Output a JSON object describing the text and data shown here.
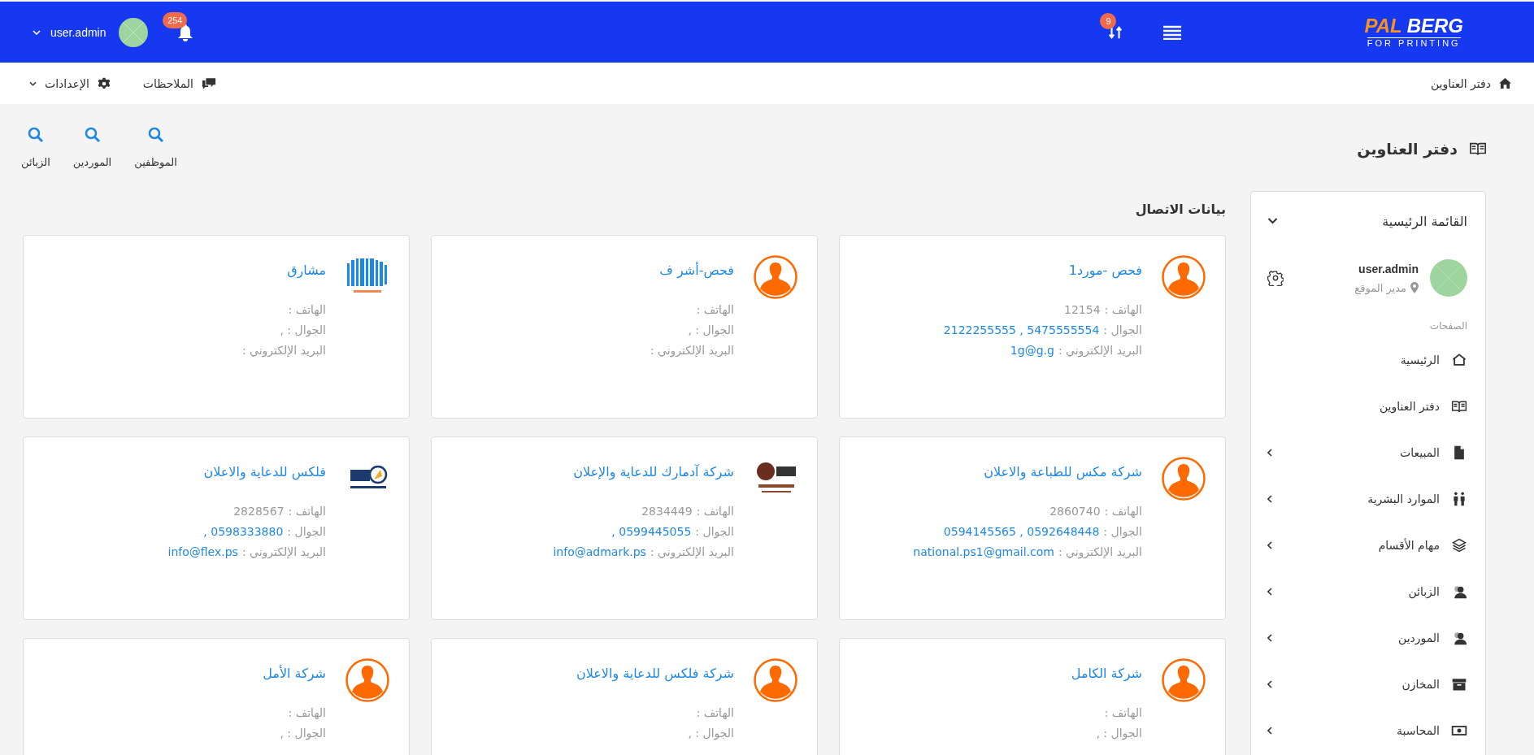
{
  "topbar": {
    "logo": {
      "words": [
        "BERG",
        "PAL"
      ],
      "tagline": "FOR PRINTING"
    },
    "sync_badge": "9",
    "notifications_badge": "254",
    "user": "user.admin"
  },
  "subbar": {
    "breadcrumb": "دفتر العناوين",
    "notes": "الملاحظات",
    "settings": "الإعدادات"
  },
  "page_title": "دفتر العناوين",
  "quick_search": [
    "الموظفين",
    "الموردين",
    "الزبائن"
  ],
  "section_title": "بيانات الاتصال",
  "contacts": [
    {
      "name": "فحص -مورد1",
      "kind": "avatar",
      "lines": [
        {
          "label": "الهاتف :",
          "value": "12154",
          "link": false
        },
        {
          "label": "الجوال :",
          "value": "5475555554 , 2122255555",
          "link": true
        },
        {
          "label": "البريد الإلكتروني :",
          "value": "1g@g.g",
          "link": true
        }
      ]
    },
    {
      "name": "فحص-أشر ف",
      "kind": "avatar",
      "lines": [
        {
          "label": "الهاتف :"
        },
        {
          "label": "الجوال : ,"
        },
        {
          "label": "البريد الإلكتروني :"
        }
      ]
    },
    {
      "name": "مشارق",
      "kind": "stripes",
      "lines": [
        {
          "label": "الهاتف :"
        },
        {
          "label": "الجوال : ,"
        },
        {
          "label": "البريد الإلكتروني :"
        }
      ]
    },
    {
      "name": "شركة مكس للطباعة والاعلان",
      "kind": "avatar",
      "lines": [
        {
          "label": "الهاتف :",
          "value": "2860740",
          "link": false
        },
        {
          "label": "الجوال :",
          "value": "0592648448 , 0594145565",
          "link": true
        },
        {
          "label": "البريد الإلكتروني :",
          "value": "national.ps1@gmail.com",
          "link": true
        }
      ]
    },
    {
      "name": "شركة آدمارك للدعاية والإعلان",
      "kind": "monogram",
      "lines": [
        {
          "label": "الهاتف :",
          "value": "2834449",
          "link": false
        },
        {
          "label": "الجوال :",
          "value": "0599445055 ,",
          "link": true
        },
        {
          "label": "البريد الإلكتروني :",
          "value": "info@admark.ps",
          "link": true
        }
      ]
    },
    {
      "name": "فلكس للدعاية والاعلان",
      "kind": "emblem",
      "lines": [
        {
          "label": "الهاتف :",
          "value": "2828567",
          "link": false
        },
        {
          "label": "الجوال :",
          "value": "0598333880 ,",
          "link": true
        },
        {
          "label": "البريد الإلكتروني :",
          "value": "info@flex.ps",
          "link": true
        }
      ]
    },
    {
      "name": "شركة الكامل",
      "kind": "avatar",
      "lines": [
        {
          "label": "الهاتف :"
        },
        {
          "label": "الجوال : ,"
        }
      ]
    },
    {
      "name": "شركة فلكس للدعاية والاعلان",
      "kind": "avatar",
      "lines": [
        {
          "label": "الهاتف :"
        },
        {
          "label": "الجوال : ,"
        }
      ]
    },
    {
      "name": "شركة الأمل",
      "kind": "avatar",
      "lines": [
        {
          "label": "الهاتف :"
        },
        {
          "label": "الجوال : ,"
        }
      ]
    }
  ],
  "sidebar": {
    "title": "القائمة الرئيسية",
    "user": "user.admin",
    "role": "مدير الموقع",
    "group_label": "الصفحات",
    "items": [
      {
        "label": "الرئيسية",
        "has_submenu": false
      },
      {
        "label": "دفتر العناوين",
        "has_submenu": false
      },
      {
        "label": "المبيعات",
        "has_submenu": true
      },
      {
        "label": "الموارد البشرية",
        "has_submenu": true
      },
      {
        "label": "مهام الأقسام",
        "has_submenu": true
      },
      {
        "label": "الزبائن",
        "has_submenu": true
      },
      {
        "label": "الموردين",
        "has_submenu": true
      },
      {
        "label": "المخازن",
        "has_submenu": true
      },
      {
        "label": "المحاسبة",
        "has_submenu": true
      }
    ]
  }
}
